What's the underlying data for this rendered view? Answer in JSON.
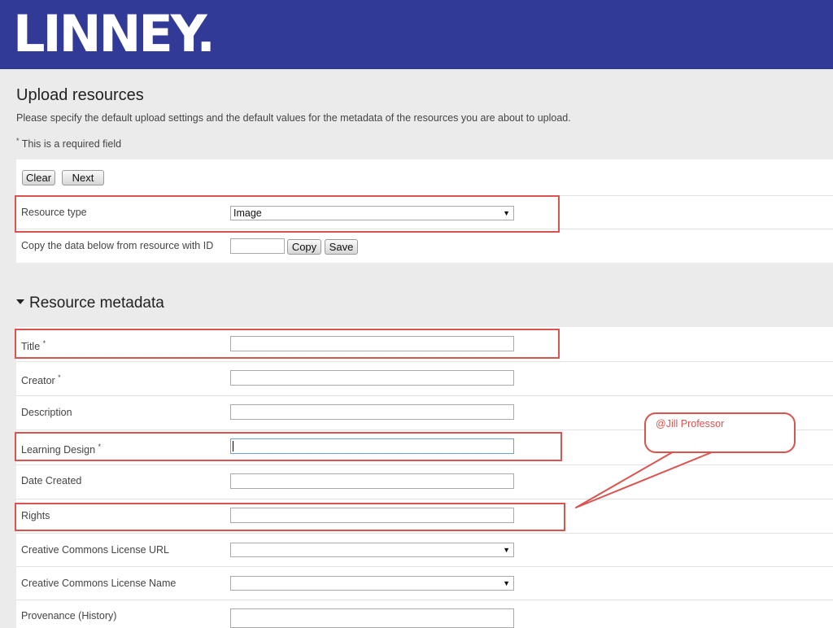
{
  "header": {
    "logo_text": "LINNEY.",
    "background": "#323a98"
  },
  "page": {
    "title": "Upload resources",
    "intro": "Please specify the default upload settings and the default values for the metadata of the resources you are about to upload.",
    "required_asterisk": "*",
    "required_note": "This is a required field"
  },
  "toolbar": {
    "clear_label": "Clear",
    "next_label": "Next"
  },
  "upload_settings": {
    "resource_type_label": "Resource type",
    "resource_type_value": "Image",
    "copy_label": "Copy the data below from resource with ID",
    "copy_id_value": "",
    "copy_button": "Copy",
    "save_button": "Save"
  },
  "metadata": {
    "section_title": "Resource metadata",
    "fields": [
      {
        "label": "Title",
        "required": "*",
        "type": "text",
        "value": ""
      },
      {
        "label": "Creator",
        "required": "*",
        "type": "text",
        "value": ""
      },
      {
        "label": "Description",
        "required": "",
        "type": "text",
        "value": ""
      },
      {
        "label": "Learning Design",
        "required": "*",
        "type": "text",
        "value": ""
      },
      {
        "label": "Date Created",
        "required": "",
        "type": "text",
        "value": ""
      },
      {
        "label": "Rights",
        "required": "",
        "type": "text",
        "value": ""
      },
      {
        "label": "Creative Commons License URL",
        "required": "",
        "type": "select",
        "value": ""
      },
      {
        "label": "Creative Commons License Name",
        "required": "",
        "type": "select",
        "value": ""
      },
      {
        "label": "Provenance (History)",
        "required": "",
        "type": "text",
        "value": ""
      }
    ]
  },
  "annotation": {
    "callout_text": "@Jill Professor",
    "color": "#d9534f"
  }
}
